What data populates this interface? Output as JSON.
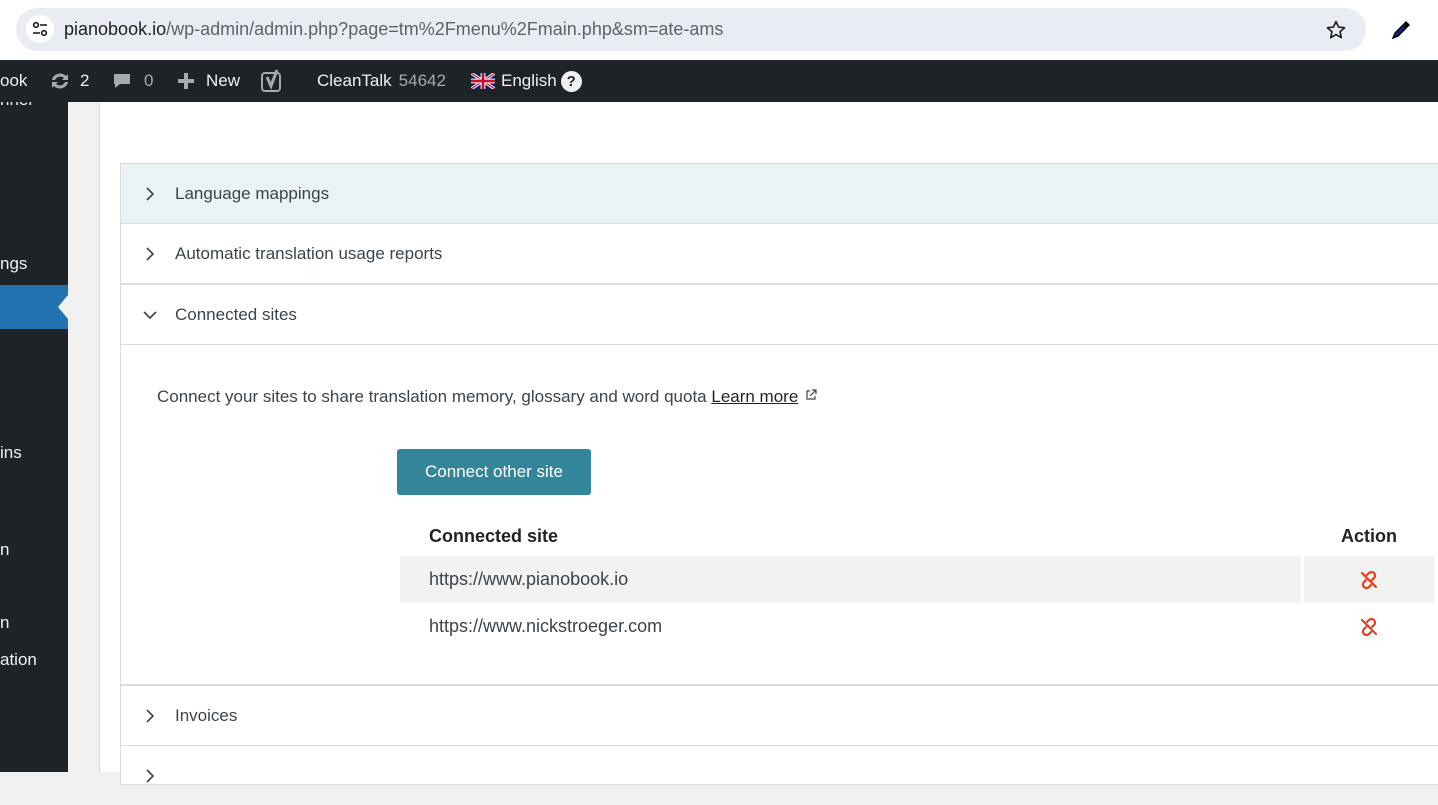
{
  "browser": {
    "url_host": "pianobook.io",
    "url_path": "/wp-admin/admin.php?page=tm%2Fmenu%2Fmain.php&sm=ate-ams"
  },
  "adminbar": {
    "site_name_partial": "ook",
    "updates_count": "2",
    "comments_count": "0",
    "new_label": "New",
    "cleantalk_label": "CleanTalk",
    "cleantalk_count": "54642",
    "language_label": "English",
    "help_label": "?"
  },
  "sidebar": {
    "items": [
      {
        "label": "nner"
      },
      {
        "label": "ngs"
      },
      {
        "label": "ins"
      },
      {
        "label": "n"
      },
      {
        "label": "n"
      },
      {
        "label": "ation"
      }
    ]
  },
  "accordions": [
    {
      "label": "Language mappings",
      "expanded": false
    },
    {
      "label": "Automatic translation usage reports",
      "expanded": false
    },
    {
      "label": "Connected sites",
      "expanded": true
    },
    {
      "label": "Invoices",
      "expanded": false
    }
  ],
  "connected_sites": {
    "description": "Connect your sites to share translation memory, glossary and word quota",
    "learn_more": "Learn more",
    "connect_button": "Connect other site",
    "table": {
      "headers": [
        "Connected site",
        "Action"
      ],
      "rows": [
        {
          "site": "https://www.pianobook.io"
        },
        {
          "site": "https://www.nickstroeger.com"
        }
      ]
    }
  },
  "colors": {
    "admin_bar": "#1d2327",
    "accent_blue": "#2271b1",
    "button_teal": "#338699",
    "unlink_red": "#e2401c"
  }
}
